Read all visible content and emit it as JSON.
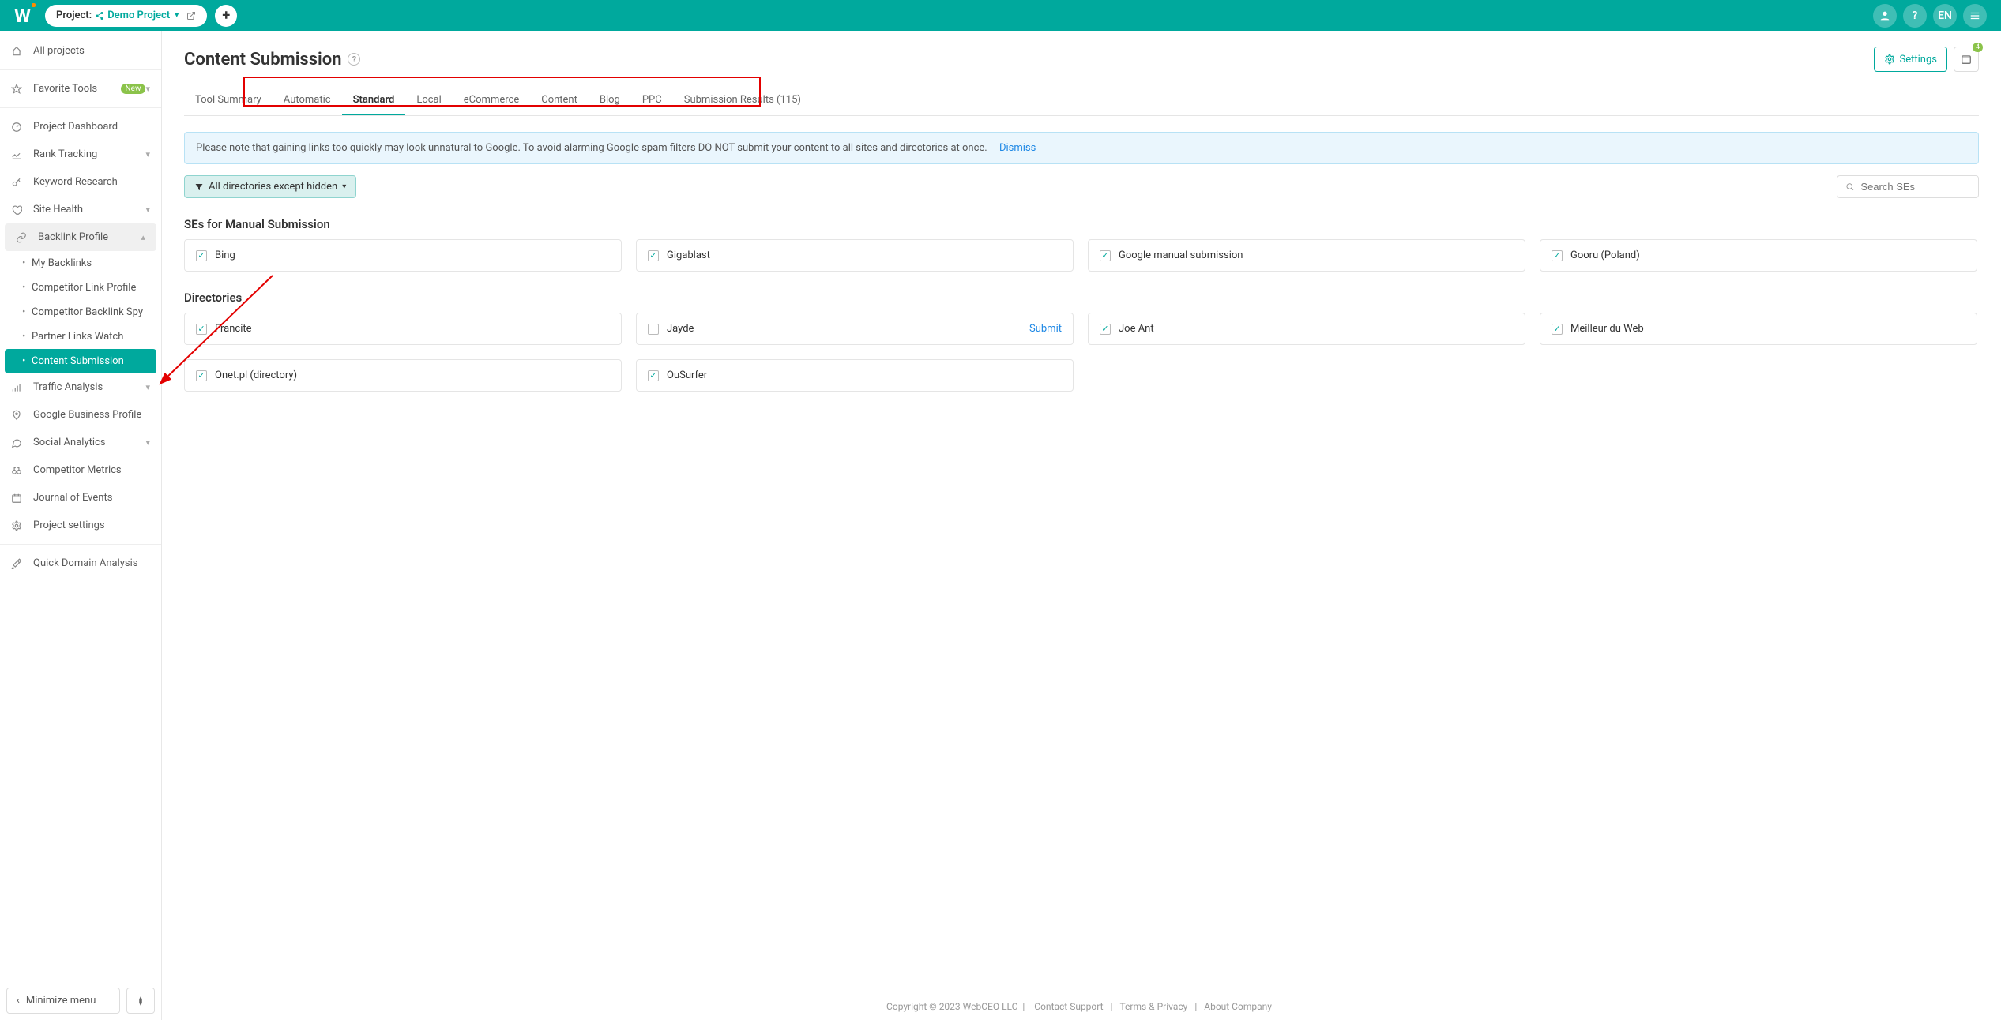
{
  "topbar": {
    "project_label": "Project:",
    "project_name": "Demo Project",
    "lang": "EN"
  },
  "sidebar": {
    "items": [
      {
        "label": "All projects"
      },
      {
        "label": "Favorite Tools",
        "badge": "New"
      },
      {
        "label": "Project Dashboard"
      },
      {
        "label": "Rank Tracking"
      },
      {
        "label": "Keyword Research"
      },
      {
        "label": "Site Health"
      },
      {
        "label": "Backlink Profile"
      },
      {
        "label": "Traffic Analysis"
      },
      {
        "label": "Google Business Profile"
      },
      {
        "label": "Social Analytics"
      },
      {
        "label": "Competitor Metrics"
      },
      {
        "label": "Journal of Events"
      },
      {
        "label": "Project settings"
      },
      {
        "label": "Quick Domain Analysis"
      }
    ],
    "subs": [
      {
        "label": "My Backlinks"
      },
      {
        "label": "Competitor Link Profile"
      },
      {
        "label": "Competitor Backlink Spy"
      },
      {
        "label": "Partner Links Watch"
      },
      {
        "label": "Content Submission"
      }
    ],
    "minimize": "Minimize menu"
  },
  "page": {
    "title": "Content Submission",
    "settings": "Settings",
    "cal_badge": "4"
  },
  "tabs": [
    "Tool Summary",
    "Automatic",
    "Standard",
    "Local",
    "eCommerce",
    "Content",
    "Blog",
    "PPC",
    "Submission Results (115)"
  ],
  "alert": {
    "text": "Please note that gaining links too quickly may look unnatural to Google. To avoid alarming Google spam filters DO NOT submit your content to all sites and directories at once.",
    "dismiss": "Dismiss"
  },
  "filter": {
    "label": "All directories except hidden"
  },
  "search": {
    "placeholder": "Search SEs"
  },
  "section1": "SEs for Manual Submission",
  "ses": [
    {
      "label": "Bing",
      "checked": true
    },
    {
      "label": "Gigablast",
      "checked": true
    },
    {
      "label": "Google manual submission",
      "checked": true
    },
    {
      "label": "Gooru (Poland)",
      "checked": true
    }
  ],
  "section2": "Directories",
  "dirs1": [
    {
      "label": "Francite",
      "checked": true
    },
    {
      "label": "Jayde",
      "checked": false,
      "submit": "Submit"
    },
    {
      "label": "Joe Ant",
      "checked": true
    },
    {
      "label": "Meilleur du Web",
      "checked": true
    }
  ],
  "dirs2": [
    {
      "label": "Onet.pl (directory)",
      "checked": true
    },
    {
      "label": "OuSurfer",
      "checked": true
    }
  ],
  "footer": {
    "copyright": "Copyright © 2023 WebCEO LLC",
    "links": [
      "Contact Support",
      "Terms & Privacy",
      "About Company"
    ]
  }
}
